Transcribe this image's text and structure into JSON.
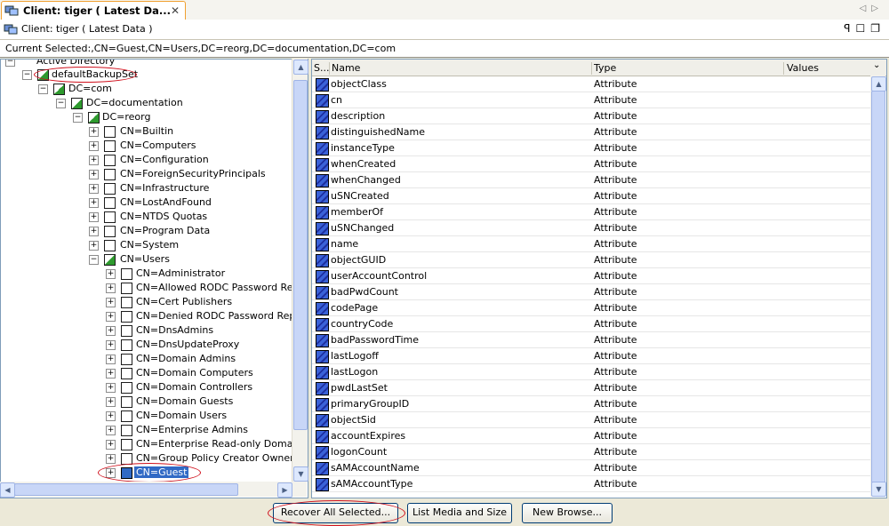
{
  "tab": {
    "title": "Client: tiger ( Latest Da...",
    "close": "✕"
  },
  "nav": {
    "back": "◁",
    "forward": "▷"
  },
  "view": {
    "title": "Client: tiger ( Latest Data )",
    "pin": "ꟼ",
    "minimize": "☐",
    "maximize": "❐"
  },
  "current_selected": "Current Selected:,CN=Guest,CN=Users,DC=reorg,DC=documentation,DC=com",
  "tree": {
    "root": "Active Directory",
    "backupset": "defaultBackupSet",
    "dc_com": "DC=com",
    "dc_documentation": "DC=documentation",
    "dc_reorg": "DC=reorg",
    "level4": [
      "CN=Builtin",
      "CN=Computers",
      "CN=Configuration",
      "CN=ForeignSecurityPrincipals",
      "CN=Infrastructure",
      "CN=LostAndFound",
      "CN=NTDS Quotas",
      "CN=Program Data",
      "CN=System",
      "CN=Users"
    ],
    "users": [
      "CN=Administrator",
      "CN=Allowed RODC Password Replica",
      "CN=Cert Publishers",
      "CN=Denied RODC Password Replica",
      "CN=DnsAdmins",
      "CN=DnsUpdateProxy",
      "CN=Domain Admins",
      "CN=Domain Computers",
      "CN=Domain Controllers",
      "CN=Domain Guests",
      "CN=Domain Users",
      "CN=Enterprise Admins",
      "CN=Enterprise Read-only Domain Co",
      "CN=Group Policy Creator Owners",
      "CN=Guest"
    ]
  },
  "table": {
    "headers": {
      "s": "S...",
      "name": "Name",
      "type": "Type",
      "values": "Values"
    },
    "rows": [
      {
        "name": "objectClass",
        "type": "Attribute"
      },
      {
        "name": "cn",
        "type": "Attribute"
      },
      {
        "name": "description",
        "type": "Attribute"
      },
      {
        "name": "distinguishedName",
        "type": "Attribute"
      },
      {
        "name": "instanceType",
        "type": "Attribute"
      },
      {
        "name": "whenCreated",
        "type": "Attribute"
      },
      {
        "name": "whenChanged",
        "type": "Attribute"
      },
      {
        "name": "uSNCreated",
        "type": "Attribute"
      },
      {
        "name": "memberOf",
        "type": "Attribute"
      },
      {
        "name": "uSNChanged",
        "type": "Attribute"
      },
      {
        "name": "name",
        "type": "Attribute"
      },
      {
        "name": "objectGUID",
        "type": "Attribute"
      },
      {
        "name": "userAccountControl",
        "type": "Attribute"
      },
      {
        "name": "badPwdCount",
        "type": "Attribute"
      },
      {
        "name": "codePage",
        "type": "Attribute"
      },
      {
        "name": "countryCode",
        "type": "Attribute"
      },
      {
        "name": "badPasswordTime",
        "type": "Attribute"
      },
      {
        "name": "lastLogoff",
        "type": "Attribute"
      },
      {
        "name": "lastLogon",
        "type": "Attribute"
      },
      {
        "name": "pwdLastSet",
        "type": "Attribute"
      },
      {
        "name": "primaryGroupID",
        "type": "Attribute"
      },
      {
        "name": "objectSid",
        "type": "Attribute"
      },
      {
        "name": "accountExpires",
        "type": "Attribute"
      },
      {
        "name": "logonCount",
        "type": "Attribute"
      },
      {
        "name": "sAMAccountName",
        "type": "Attribute"
      },
      {
        "name": "sAMAccountType",
        "type": "Attribute"
      }
    ]
  },
  "buttons": {
    "recover": "Recover All Selected...",
    "list_media": "List Media and Size",
    "new_browse": "New Browse..."
  },
  "colors": {
    "selection": "#316ac5",
    "annotation": "#d0101c",
    "tab_border": "#f0a030"
  }
}
